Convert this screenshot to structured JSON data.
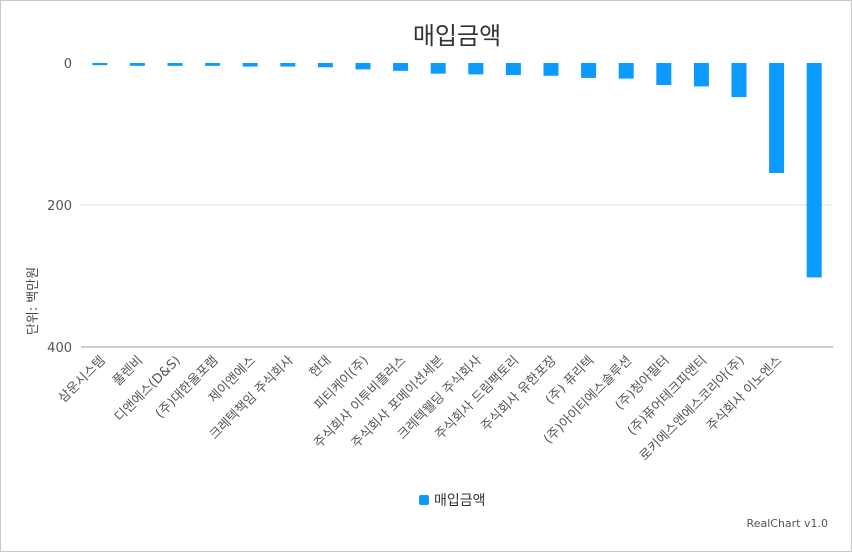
{
  "chart_data": {
    "type": "bar",
    "title": "매입금액",
    "ylabel": "단위: 백만원",
    "xlabel": "",
    "y_reversed": true,
    "ylim": [
      0,
      400
    ],
    "yticks": [
      0,
      200,
      400
    ],
    "categories": [
      "삼운시스템",
      "풀렌비",
      "디앤에스(D&S)",
      "(주)대한울포램",
      "제이앤에스",
      "크레텍책임 주식회사",
      "현대",
      "피티케이(주)",
      "주식회사 이투비플러스",
      "주식회사 포메이션세븐",
      "크레텍웰딩 주식회사",
      "주식회사 드림팩토리",
      "주식회사 유한포장",
      "(주) 퓨리텍",
      "(주)아이티에스솔루션",
      "(주)청아필터",
      "(주)퓨어테크피앤티",
      "로키에스앤에스코리아(주)",
      "주식회사 이노엔스"
    ],
    "series": [
      {
        "name": "매입금액",
        "color": "#0b9bff",
        "values": [
          3,
          4,
          4,
          4,
          5,
          5,
          6,
          9,
          11,
          15,
          16,
          17,
          18,
          21,
          22,
          31,
          33,
          48,
          155,
          302
        ]
      }
    ],
    "legend": {
      "position": "bottom",
      "label": "매입금액"
    },
    "grid": {
      "horizontal": true,
      "color": "#e0e0e0"
    },
    "credit": "RealChart v1.0"
  }
}
